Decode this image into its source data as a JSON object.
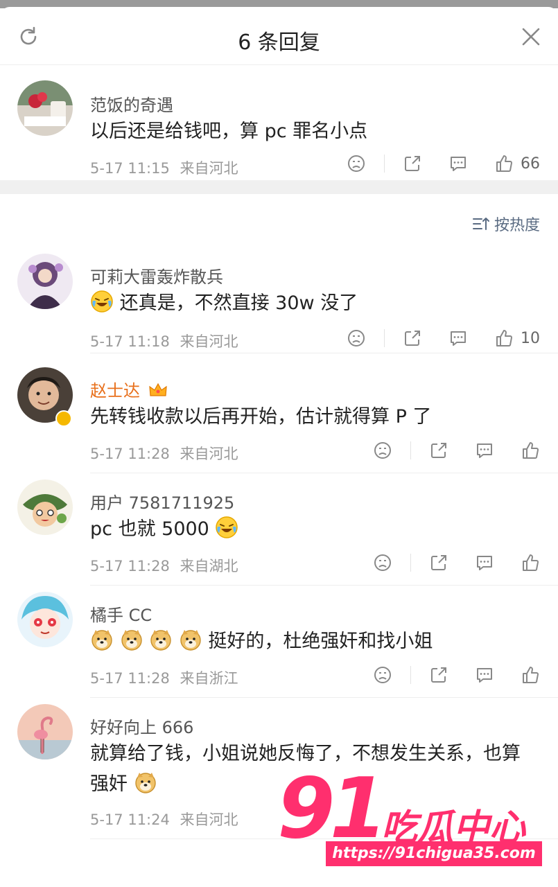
{
  "header": {
    "title": "6 条回复"
  },
  "pinned": {
    "name": "范饭的奇遇",
    "text": "以后还是给钱吧，算 pc 罪名小点",
    "time": "5-17 11:15",
    "location": "来自河北",
    "likes": "66"
  },
  "sort": {
    "label": "按热度"
  },
  "comments": [
    {
      "name": "可莉大雷轰炸散兵",
      "text": "还真是，不然直接 30w 没了",
      "time": "5-17 11:18",
      "location": "来自河北",
      "likes": "10"
    },
    {
      "name": "赵士达",
      "text": "先转钱收款以后再开始，估计就得算 P 了",
      "time": "5-17 11:28",
      "location": "来自河北",
      "likes": ""
    },
    {
      "name": "用户 7581711925",
      "text": "pc 也就 5000",
      "time": "5-17 11:28",
      "location": "来自湖北",
      "likes": ""
    },
    {
      "name": "橘手 CC",
      "text": "挺好的，杜绝强奸和找小姐",
      "time": "5-17 11:28",
      "location": "来自浙江",
      "likes": ""
    },
    {
      "name": "好好向上 666",
      "text": "就算给了钱，小姐说她反悔了，不想发生关系，也算强奸",
      "time": "5-17 11:24",
      "location": "来自河北",
      "likes": ""
    }
  ],
  "watermark": {
    "number": "91",
    "brand": "吃瓜中心",
    "url": "https://91chigua35.com"
  },
  "colors": {
    "accent_vip": "#e8701c",
    "watermark": "#ff2f6e",
    "meta": "#999999"
  }
}
